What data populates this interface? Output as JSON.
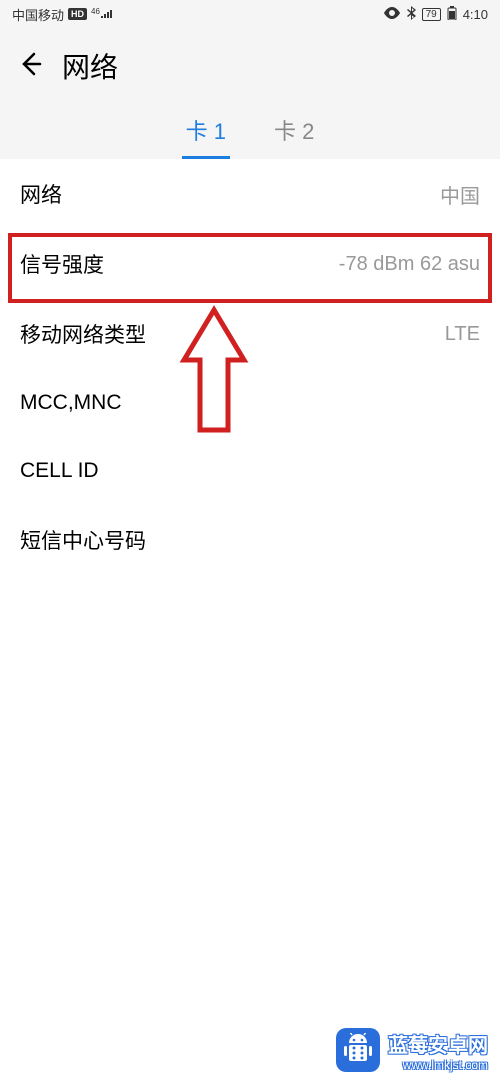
{
  "status_bar": {
    "carrier": "中国移动",
    "hd_label": "HD",
    "net_label": "4G",
    "battery": "79",
    "time": "4:10"
  },
  "header": {
    "title": "网络"
  },
  "tabs": {
    "tab1": "卡 1",
    "tab2": "卡 2"
  },
  "rows": [
    {
      "label": "网络",
      "value": "中国"
    },
    {
      "label": "信号强度",
      "value": "-78 dBm   62 asu"
    },
    {
      "label": "移动网络类型",
      "value": "LTE"
    },
    {
      "label": "MCC,MNC",
      "value": ""
    },
    {
      "label": "CELL ID",
      "value": ""
    },
    {
      "label": "短信中心号码",
      "value": ""
    }
  ],
  "watermark": {
    "title": "蓝莓安卓网",
    "url": "www.lmkjst.com"
  }
}
